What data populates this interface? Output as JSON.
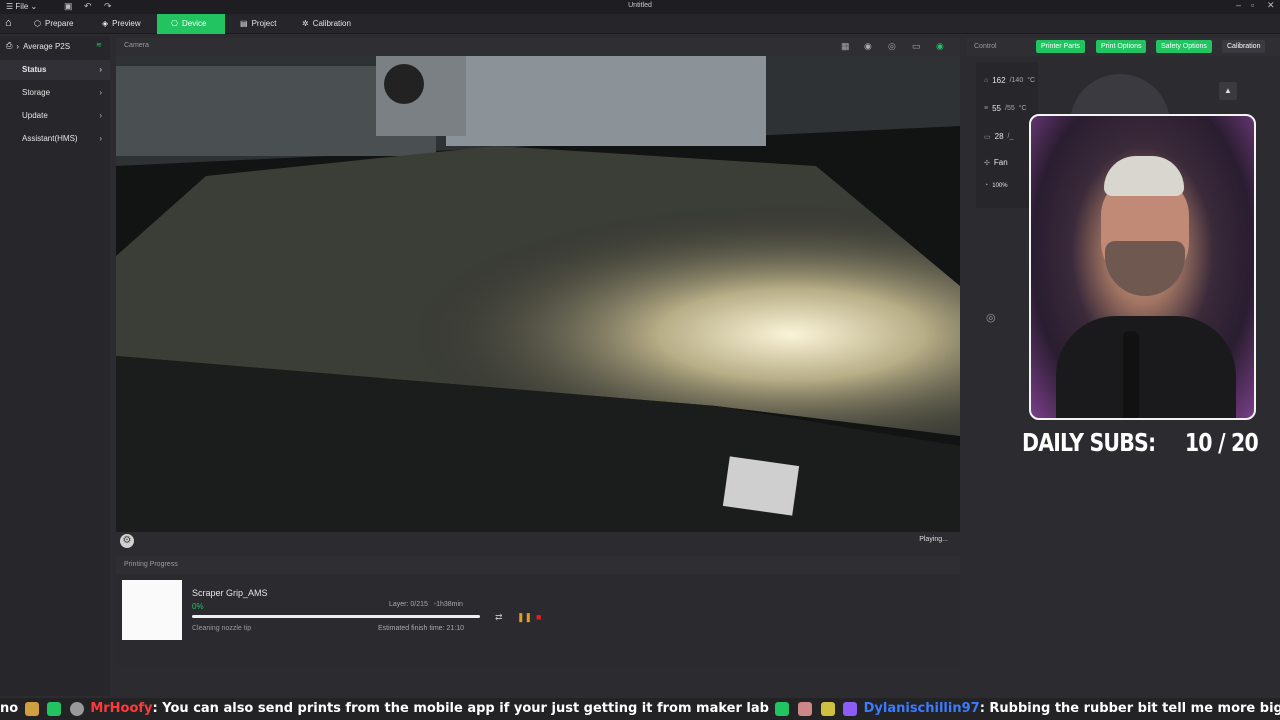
{
  "titlebar": {
    "file_label": "File",
    "window_title": "Untitled"
  },
  "nav": {
    "tabs": [
      {
        "label": "Prepare",
        "icon": "prepare-icon"
      },
      {
        "label": "Preview",
        "icon": "preview-icon"
      },
      {
        "label": "Device",
        "icon": "device-icon",
        "active": true
      },
      {
        "label": "Project",
        "icon": "project-icon"
      },
      {
        "label": "Calibration",
        "icon": "calibration-icon"
      }
    ]
  },
  "sidebar": {
    "printer_name": "Average P2S",
    "items": [
      {
        "label": "Status",
        "active": true
      },
      {
        "label": "Storage"
      },
      {
        "label": "Update"
      },
      {
        "label": "Assistant(HMS)"
      }
    ]
  },
  "camera": {
    "label": "Camera",
    "status": "Playing..."
  },
  "progress": {
    "label": "Printing Progress",
    "job_name": "Scraper Grip_AMS",
    "percent": "0%",
    "percent_value": 0,
    "layer": "Layer: 0/215",
    "remaining": "-1h38min",
    "status": "Cleaning nozzle tip",
    "finish_time": "Estimated finish time: 21:10"
  },
  "control": {
    "label": "Control",
    "buttons": [
      "Printer Parts",
      "Print Options",
      "Safety Options",
      "Calibration"
    ],
    "temps": [
      {
        "current": "162",
        "target": "/140",
        "unit": "°C"
      },
      {
        "current": "55",
        "target": "/55",
        "unit": "°C"
      },
      {
        "current": "28",
        "target": "/_",
        "unit": ""
      }
    ],
    "fan_label": "Fan",
    "speed": "100%"
  },
  "overlay": {
    "daily_subs_label": "DAILY SUBS:",
    "daily_subs_value": "10 / 20"
  },
  "ticker": {
    "prefix": "no",
    "user1": "MrHoofy",
    "msg1": ": You can also send prints from the mobile app if your just getting it from maker lab",
    "user2": "Dylanischillin97",
    "msg2": ": Rubbing the rubber bit tell me more big boy."
  },
  "colors": {
    "accent": "#21c460",
    "stop": "#e02020",
    "pause": "#e0a020"
  }
}
